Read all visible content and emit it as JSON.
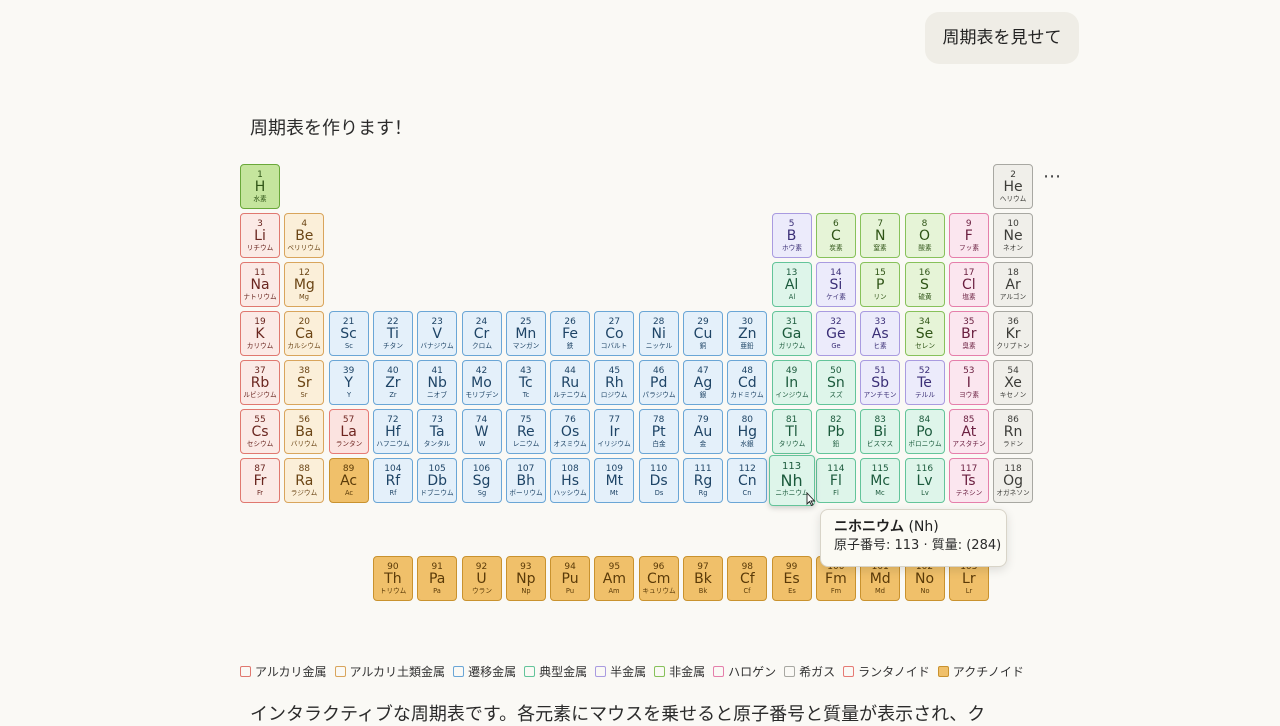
{
  "chat": {
    "user_message": "周期表を見せて",
    "assistant_intro": "周期表を作ります！",
    "assistant_outro": "インタラクティブな周期表です。各元素にマウスを乗せると原子番号と質量が表示され、ク",
    "more_icon": "more-horizontal-icon",
    "more_label": "⋯"
  },
  "categories": {
    "alkali": {
      "label": "アルカリ金属",
      "border": "#e0786f",
      "fill": "#fbeae6",
      "text": "#6a2620"
    },
    "alkaline": {
      "label": "アルカリ土類金属",
      "border": "#d9a55c",
      "fill": "#fbefd9",
      "text": "#6b4515"
    },
    "transition": {
      "label": "遷移金属",
      "border": "#6aa6d6",
      "fill": "#e4f0fa",
      "text": "#1e4466"
    },
    "post": {
      "label": "典型金属",
      "border": "#63c49a",
      "fill": "#def5ea",
      "text": "#1b5a3c"
    },
    "metalloid": {
      "label": "半金属",
      "border": "#a99be0",
      "fill": "#ecebfb",
      "text": "#3b2f77"
    },
    "nonmetal": {
      "label": "非金属",
      "border": "#87c15a",
      "fill": "#e6f4d7",
      "text": "#2f5416"
    },
    "halogen": {
      "label": "ハロゲン",
      "border": "#e57fab",
      "fill": "#fbe6ef",
      "text": "#6a1e3f"
    },
    "noble": {
      "label": "希ガス",
      "border": "#a8a8a2",
      "fill": "#f0efea",
      "text": "#3c3c38"
    },
    "lanthanide": {
      "label": "ランタノイド",
      "border": "#e67a74",
      "fill": "#fbe3e0",
      "text": "#6f2520"
    },
    "actinide": {
      "label": "アクチノイド",
      "border": "#c9922e",
      "fill": "#f0c06a",
      "text": "#5a3a08"
    }
  },
  "legend_order": [
    "alkali",
    "alkaline",
    "transition",
    "post",
    "metalloid",
    "nonmetal",
    "halogen",
    "noble",
    "lanthanide",
    "actinide"
  ],
  "elements": [
    {
      "n": 1,
      "sym": "H",
      "jp": "水素",
      "row": 1,
      "col": 1,
      "cat": "nonmetal",
      "fill": "#c5e59d",
      "border": "#6aa83a"
    },
    {
      "n": 2,
      "sym": "He",
      "jp": "ヘリウム",
      "row": 1,
      "col": 18,
      "cat": "noble"
    },
    {
      "n": 3,
      "sym": "Li",
      "jp": "リチウム",
      "row": 2,
      "col": 1,
      "cat": "alkali"
    },
    {
      "n": 4,
      "sym": "Be",
      "jp": "ベリリウム",
      "row": 2,
      "col": 2,
      "cat": "alkaline"
    },
    {
      "n": 5,
      "sym": "B",
      "jp": "ホウ素",
      "row": 2,
      "col": 13,
      "cat": "metalloid"
    },
    {
      "n": 6,
      "sym": "C",
      "jp": "炭素",
      "row": 2,
      "col": 14,
      "cat": "nonmetal"
    },
    {
      "n": 7,
      "sym": "N",
      "jp": "窒素",
      "row": 2,
      "col": 15,
      "cat": "nonmetal"
    },
    {
      "n": 8,
      "sym": "O",
      "jp": "酸素",
      "row": 2,
      "col": 16,
      "cat": "nonmetal"
    },
    {
      "n": 9,
      "sym": "F",
      "jp": "フッ素",
      "row": 2,
      "col": 17,
      "cat": "halogen"
    },
    {
      "n": 10,
      "sym": "Ne",
      "jp": "ネオン",
      "row": 2,
      "col": 18,
      "cat": "noble"
    },
    {
      "n": 11,
      "sym": "Na",
      "jp": "ナトリウム",
      "row": 3,
      "col": 1,
      "cat": "alkali"
    },
    {
      "n": 12,
      "sym": "Mg",
      "jp": "Mg",
      "row": 3,
      "col": 2,
      "cat": "alkaline"
    },
    {
      "n": 13,
      "sym": "Al",
      "jp": "Al",
      "row": 3,
      "col": 13,
      "cat": "post"
    },
    {
      "n": 14,
      "sym": "Si",
      "jp": "ケイ素",
      "row": 3,
      "col": 14,
      "cat": "metalloid"
    },
    {
      "n": 15,
      "sym": "P",
      "jp": "リン",
      "row": 3,
      "col": 15,
      "cat": "nonmetal"
    },
    {
      "n": 16,
      "sym": "S",
      "jp": "硫黄",
      "row": 3,
      "col": 16,
      "cat": "nonmetal"
    },
    {
      "n": 17,
      "sym": "Cl",
      "jp": "塩素",
      "row": 3,
      "col": 17,
      "cat": "halogen"
    },
    {
      "n": 18,
      "sym": "Ar",
      "jp": "アルゴン",
      "row": 3,
      "col": 18,
      "cat": "noble"
    },
    {
      "n": 19,
      "sym": "K",
      "jp": "カリウム",
      "row": 4,
      "col": 1,
      "cat": "alkali"
    },
    {
      "n": 20,
      "sym": "Ca",
      "jp": "カルシウム",
      "row": 4,
      "col": 2,
      "cat": "alkaline"
    },
    {
      "n": 21,
      "sym": "Sc",
      "jp": "Sc",
      "row": 4,
      "col": 3,
      "cat": "transition"
    },
    {
      "n": 22,
      "sym": "Ti",
      "jp": "チタン",
      "row": 4,
      "col": 4,
      "cat": "transition"
    },
    {
      "n": 23,
      "sym": "V",
      "jp": "バナジウム",
      "row": 4,
      "col": 5,
      "cat": "transition"
    },
    {
      "n": 24,
      "sym": "Cr",
      "jp": "クロム",
      "row": 4,
      "col": 6,
      "cat": "transition"
    },
    {
      "n": 25,
      "sym": "Mn",
      "jp": "マンガン",
      "row": 4,
      "col": 7,
      "cat": "transition"
    },
    {
      "n": 26,
      "sym": "Fe",
      "jp": "鉄",
      "row": 4,
      "col": 8,
      "cat": "transition"
    },
    {
      "n": 27,
      "sym": "Co",
      "jp": "コバルト",
      "row": 4,
      "col": 9,
      "cat": "transition"
    },
    {
      "n": 28,
      "sym": "Ni",
      "jp": "ニッケル",
      "row": 4,
      "col": 10,
      "cat": "transition"
    },
    {
      "n": 29,
      "sym": "Cu",
      "jp": "銅",
      "row": 4,
      "col": 11,
      "cat": "transition"
    },
    {
      "n": 30,
      "sym": "Zn",
      "jp": "亜鉛",
      "row": 4,
      "col": 12,
      "cat": "transition"
    },
    {
      "n": 31,
      "sym": "Ga",
      "jp": "ガリウム",
      "row": 4,
      "col": 13,
      "cat": "post"
    },
    {
      "n": 32,
      "sym": "Ge",
      "jp": "Ge",
      "row": 4,
      "col": 14,
      "cat": "metalloid"
    },
    {
      "n": 33,
      "sym": "As",
      "jp": "ヒ素",
      "row": 4,
      "col": 15,
      "cat": "metalloid"
    },
    {
      "n": 34,
      "sym": "Se",
      "jp": "セレン",
      "row": 4,
      "col": 16,
      "cat": "nonmetal"
    },
    {
      "n": 35,
      "sym": "Br",
      "jp": "臭素",
      "row": 4,
      "col": 17,
      "cat": "halogen"
    },
    {
      "n": 36,
      "sym": "Kr",
      "jp": "クリプトン",
      "row": 4,
      "col": 18,
      "cat": "noble"
    },
    {
      "n": 37,
      "sym": "Rb",
      "jp": "ルビジウム",
      "row": 5,
      "col": 1,
      "cat": "alkali"
    },
    {
      "n": 38,
      "sym": "Sr",
      "jp": "Sr",
      "row": 5,
      "col": 2,
      "cat": "alkaline"
    },
    {
      "n": 39,
      "sym": "Y",
      "jp": "Y",
      "row": 5,
      "col": 3,
      "cat": "transition"
    },
    {
      "n": 40,
      "sym": "Zr",
      "jp": "Zr",
      "row": 5,
      "col": 4,
      "cat": "transition"
    },
    {
      "n": 41,
      "sym": "Nb",
      "jp": "ニオブ",
      "row": 5,
      "col": 5,
      "cat": "transition"
    },
    {
      "n": 42,
      "sym": "Mo",
      "jp": "モリブデン",
      "row": 5,
      "col": 6,
      "cat": "transition"
    },
    {
      "n": 43,
      "sym": "Tc",
      "jp": "Tc",
      "row": 5,
      "col": 7,
      "cat": "transition"
    },
    {
      "n": 44,
      "sym": "Ru",
      "jp": "ルテニウム",
      "row": 5,
      "col": 8,
      "cat": "transition"
    },
    {
      "n": 45,
      "sym": "Rh",
      "jp": "ロジウム",
      "row": 5,
      "col": 9,
      "cat": "transition"
    },
    {
      "n": 46,
      "sym": "Pd",
      "jp": "パラジウム",
      "row": 5,
      "col": 10,
      "cat": "transition"
    },
    {
      "n": 47,
      "sym": "Ag",
      "jp": "銀",
      "row": 5,
      "col": 11,
      "cat": "transition"
    },
    {
      "n": 48,
      "sym": "Cd",
      "jp": "カドミウム",
      "row": 5,
      "col": 12,
      "cat": "transition"
    },
    {
      "n": 49,
      "sym": "In",
      "jp": "インジウム",
      "row": 5,
      "col": 13,
      "cat": "post"
    },
    {
      "n": 50,
      "sym": "Sn",
      "jp": "スズ",
      "row": 5,
      "col": 14,
      "cat": "post"
    },
    {
      "n": 51,
      "sym": "Sb",
      "jp": "アンチモン",
      "row": 5,
      "col": 15,
      "cat": "metalloid"
    },
    {
      "n": 52,
      "sym": "Te",
      "jp": "テルル",
      "row": 5,
      "col": 16,
      "cat": "metalloid"
    },
    {
      "n": 53,
      "sym": "I",
      "jp": "ヨウ素",
      "row": 5,
      "col": 17,
      "cat": "halogen"
    },
    {
      "n": 54,
      "sym": "Xe",
      "jp": "キセノン",
      "row": 5,
      "col": 18,
      "cat": "noble"
    },
    {
      "n": 55,
      "sym": "Cs",
      "jp": "セシウム",
      "row": 6,
      "col": 1,
      "cat": "alkali"
    },
    {
      "n": 56,
      "sym": "Ba",
      "jp": "バリウム",
      "row": 6,
      "col": 2,
      "cat": "alkaline"
    },
    {
      "n": 57,
      "sym": "La",
      "jp": "ランタン",
      "row": 6,
      "col": 3,
      "cat": "lanthanide"
    },
    {
      "n": 72,
      "sym": "Hf",
      "jp": "ハフニウム",
      "row": 6,
      "col": 4,
      "cat": "transition"
    },
    {
      "n": 73,
      "sym": "Ta",
      "jp": "タンタル",
      "row": 6,
      "col": 5,
      "cat": "transition"
    },
    {
      "n": 74,
      "sym": "W",
      "jp": "W",
      "row": 6,
      "col": 6,
      "cat": "transition"
    },
    {
      "n": 75,
      "sym": "Re",
      "jp": "レニウム",
      "row": 6,
      "col": 7,
      "cat": "transition"
    },
    {
      "n": 76,
      "sym": "Os",
      "jp": "オスミウム",
      "row": 6,
      "col": 8,
      "cat": "transition"
    },
    {
      "n": 77,
      "sym": "Ir",
      "jp": "イリジウム",
      "row": 6,
      "col": 9,
      "cat": "transition"
    },
    {
      "n": 78,
      "sym": "Pt",
      "jp": "白金",
      "row": 6,
      "col": 10,
      "cat": "transition"
    },
    {
      "n": 79,
      "sym": "Au",
      "jp": "金",
      "row": 6,
      "col": 11,
      "cat": "transition"
    },
    {
      "n": 80,
      "sym": "Hg",
      "jp": "水銀",
      "row": 6,
      "col": 12,
      "cat": "transition"
    },
    {
      "n": 81,
      "sym": "Tl",
      "jp": "タリウム",
      "row": 6,
      "col": 13,
      "cat": "post"
    },
    {
      "n": 82,
      "sym": "Pb",
      "jp": "鉛",
      "row": 6,
      "col": 14,
      "cat": "post"
    },
    {
      "n": 83,
      "sym": "Bi",
      "jp": "ビスマス",
      "row": 6,
      "col": 15,
      "cat": "post"
    },
    {
      "n": 84,
      "sym": "Po",
      "jp": "ポロニウム",
      "row": 6,
      "col": 16,
      "cat": "post"
    },
    {
      "n": 85,
      "sym": "At",
      "jp": "アスタチン",
      "row": 6,
      "col": 17,
      "cat": "halogen"
    },
    {
      "n": 86,
      "sym": "Rn",
      "jp": "ラドン",
      "row": 6,
      "col": 18,
      "cat": "noble"
    },
    {
      "n": 87,
      "sym": "Fr",
      "jp": "Fr",
      "row": 7,
      "col": 1,
      "cat": "alkali"
    },
    {
      "n": 88,
      "sym": "Ra",
      "jp": "ラジウム",
      "row": 7,
      "col": 2,
      "cat": "alkaline"
    },
    {
      "n": 89,
      "sym": "Ac",
      "jp": "Ac",
      "row": 7,
      "col": 3,
      "cat": "actinide"
    },
    {
      "n": 104,
      "sym": "Rf",
      "jp": "Rf",
      "row": 7,
      "col": 4,
      "cat": "transition"
    },
    {
      "n": 105,
      "sym": "Db",
      "jp": "ドブニウム",
      "row": 7,
      "col": 5,
      "cat": "transition"
    },
    {
      "n": 106,
      "sym": "Sg",
      "jp": "Sg",
      "row": 7,
      "col": 6,
      "cat": "transition"
    },
    {
      "n": 107,
      "sym": "Bh",
      "jp": "ボーリウム",
      "row": 7,
      "col": 7,
      "cat": "transition"
    },
    {
      "n": 108,
      "sym": "Hs",
      "jp": "ハッシウム",
      "row": 7,
      "col": 8,
      "cat": "transition"
    },
    {
      "n": 109,
      "sym": "Mt",
      "jp": "Mt",
      "row": 7,
      "col": 9,
      "cat": "transition"
    },
    {
      "n": 110,
      "sym": "Ds",
      "jp": "Ds",
      "row": 7,
      "col": 10,
      "cat": "transition"
    },
    {
      "n": 111,
      "sym": "Rg",
      "jp": "Rg",
      "row": 7,
      "col": 11,
      "cat": "transition"
    },
    {
      "n": 112,
      "sym": "Cn",
      "jp": "Cn",
      "row": 7,
      "col": 12,
      "cat": "transition"
    },
    {
      "n": 113,
      "sym": "Nh",
      "jp": "ニホニウム",
      "row": 7,
      "col": 13,
      "cat": "post",
      "hover": true
    },
    {
      "n": 114,
      "sym": "Fl",
      "jp": "Fl",
      "row": 7,
      "col": 14,
      "cat": "post"
    },
    {
      "n": 115,
      "sym": "Mc",
      "jp": "Mc",
      "row": 7,
      "col": 15,
      "cat": "post"
    },
    {
      "n": 116,
      "sym": "Lv",
      "jp": "Lv",
      "row": 7,
      "col": 16,
      "cat": "post"
    },
    {
      "n": 117,
      "sym": "Ts",
      "jp": "テネシン",
      "row": 7,
      "col": 17,
      "cat": "halogen"
    },
    {
      "n": 118,
      "sym": "Og",
      "jp": "オガネソン",
      "row": 7,
      "col": 18,
      "cat": "noble"
    },
    {
      "n": 90,
      "sym": "Th",
      "jp": "トリウム",
      "row": 9,
      "col": 4,
      "cat": "actinide"
    },
    {
      "n": 91,
      "sym": "Pa",
      "jp": "Pa",
      "row": 9,
      "col": 5,
      "cat": "actinide"
    },
    {
      "n": 92,
      "sym": "U",
      "jp": "ウラン",
      "row": 9,
      "col": 6,
      "cat": "actinide"
    },
    {
      "n": 93,
      "sym": "Np",
      "jp": "Np",
      "row": 9,
      "col": 7,
      "cat": "actinide"
    },
    {
      "n": 94,
      "sym": "Pu",
      "jp": "Pu",
      "row": 9,
      "col": 8,
      "cat": "actinide"
    },
    {
      "n": 95,
      "sym": "Am",
      "jp": "Am",
      "row": 9,
      "col": 9,
      "cat": "actinide"
    },
    {
      "n": 96,
      "sym": "Cm",
      "jp": "キュリウム",
      "row": 9,
      "col": 10,
      "cat": "actinide"
    },
    {
      "n": 97,
      "sym": "Bk",
      "jp": "Bk",
      "row": 9,
      "col": 11,
      "cat": "actinide"
    },
    {
      "n": 98,
      "sym": "Cf",
      "jp": "Cf",
      "row": 9,
      "col": 12,
      "cat": "actinide"
    },
    {
      "n": 99,
      "sym": "Es",
      "jp": "Es",
      "row": 9,
      "col": 13,
      "cat": "actinide"
    },
    {
      "n": 100,
      "sym": "Fm",
      "jp": "Fm",
      "row": 9,
      "col": 14,
      "cat": "actinide"
    },
    {
      "n": 101,
      "sym": "Md",
      "jp": "Md",
      "row": 9,
      "col": 15,
      "cat": "actinide"
    },
    {
      "n": 102,
      "sym": "No",
      "jp": "No",
      "row": 9,
      "col": 16,
      "cat": "actinide"
    },
    {
      "n": 103,
      "sym": "Lr",
      "jp": "Lr",
      "row": 9,
      "col": 17,
      "cat": "actinide"
    }
  ],
  "tooltip": {
    "name": "ニホニウム",
    "symbol": "(Nh)",
    "detail": "原子番号: 113 · 質量: (284)"
  }
}
